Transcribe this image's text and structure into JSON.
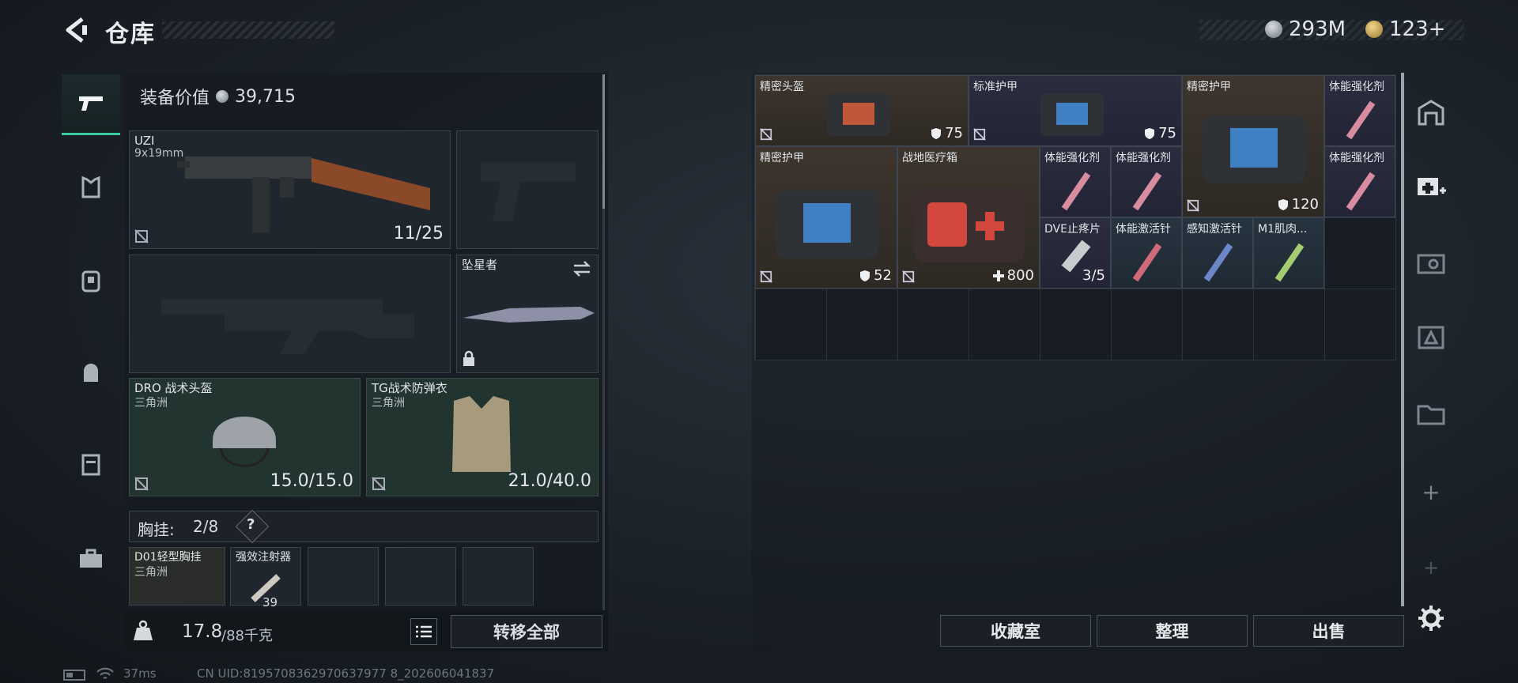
{
  "header": {
    "title": "仓库",
    "currency_silver": "293M",
    "currency_gold": "123+"
  },
  "left": {
    "equipment_value_label": "装备价值",
    "equipment_value": "39,715",
    "primary_weapon": {
      "name": "UZI",
      "ammo_type": "9x19mm",
      "ammo": "11/25"
    },
    "melee": {
      "name": "坠星者"
    },
    "helmet": {
      "name": "DRO 战术头盔",
      "map": "三角洲",
      "durability": "15.0/15.0"
    },
    "armor": {
      "name": "TG战术防弹衣",
      "map": "三角洲",
      "durability": "21.0/40.0"
    },
    "chest_rig": {
      "label": "胸挂:",
      "count": "2/8",
      "help": "?"
    },
    "rig_items": [
      {
        "name": "D01轻型胸挂",
        "map": "三角洲"
      },
      {
        "name": "强效注射器",
        "value": "39"
      }
    ],
    "weight": {
      "value": "17.8",
      "max": "/88千克"
    },
    "transfer_all": "转移全部"
  },
  "grid": {
    "items": [
      {
        "name": "精密头盔",
        "value": "75"
      },
      {
        "name": "标准护甲",
        "value": "75"
      },
      {
        "name": "精密护甲",
        "value": "120"
      },
      {
        "name": "体能强化剂"
      },
      {
        "name": "精密护甲",
        "value": "52"
      },
      {
        "name": "战地医疗箱",
        "value": "800"
      },
      {
        "name": "体能强化剂"
      },
      {
        "name": "体能强化剂"
      },
      {
        "name": "体能强化剂"
      },
      {
        "name": "DVE止疼片",
        "value": "3/5"
      },
      {
        "name": "体能激活针"
      },
      {
        "name": "感知激活针"
      },
      {
        "name": "M1肌肉..."
      }
    ]
  },
  "buttons": {
    "collection": "收藏室",
    "organize": "整理",
    "sell": "出售"
  },
  "status": {
    "ping": "37ms",
    "uid": "CN UID:8195708362970637977 8_202606041837"
  },
  "colors": {
    "accent": "#3cc9a5",
    "brown_slot": "#3d352e",
    "purple_slot": "#2b2c3e",
    "teal_slot": "#263440"
  }
}
